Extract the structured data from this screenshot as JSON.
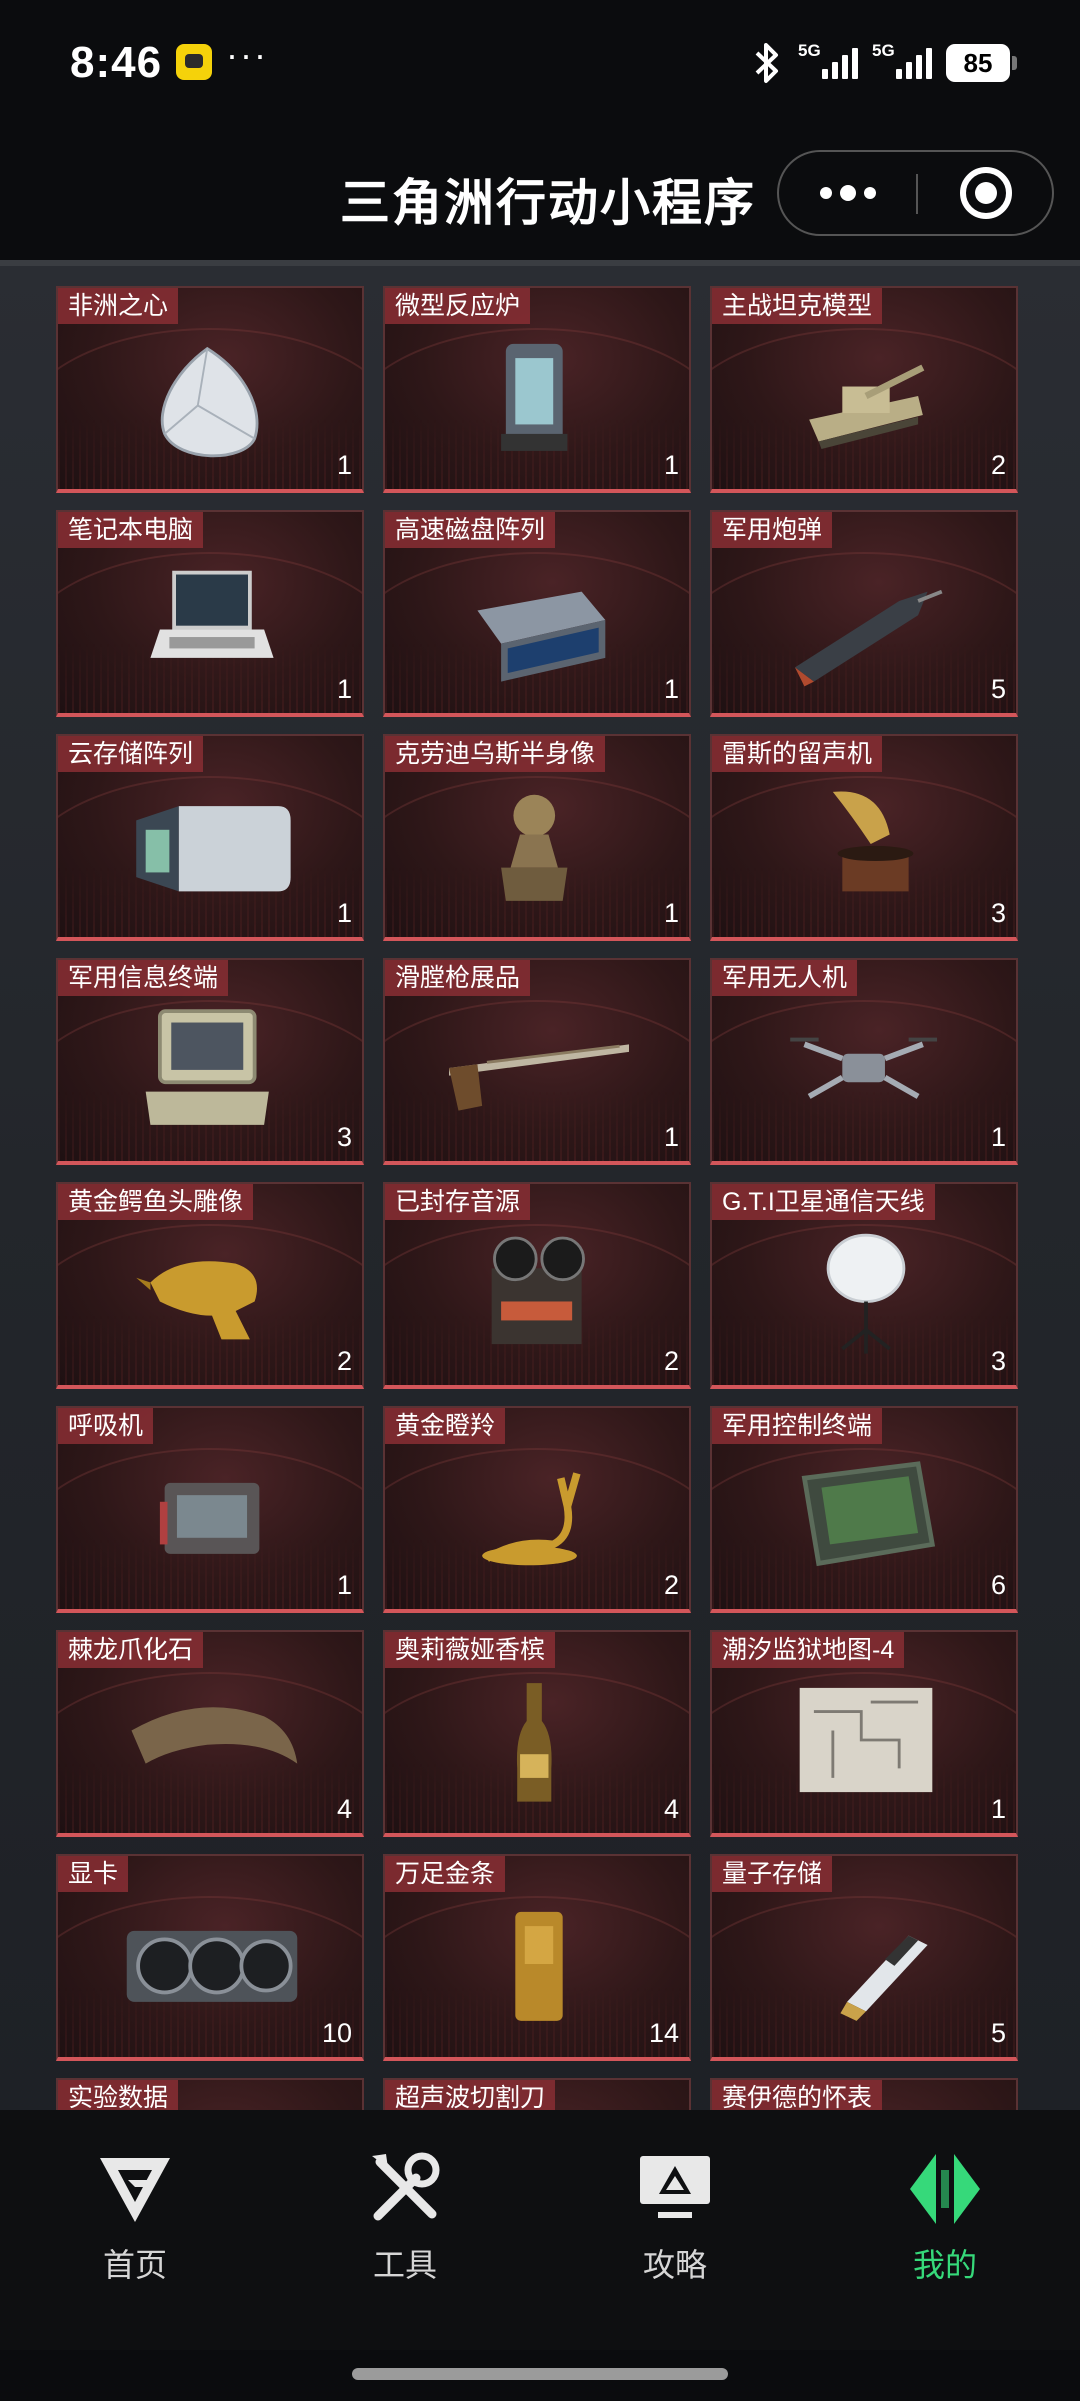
{
  "status_bar": {
    "time": "8:46",
    "more": "···",
    "signal1": "5G",
    "signal2": "5G",
    "battery": "85"
  },
  "header": {
    "title": "三角洲行动小程序"
  },
  "items": [
    {
      "name": "非洲之心",
      "count": "1",
      "icon": "diamond-icon"
    },
    {
      "name": "微型反应炉",
      "count": "1",
      "icon": "reactor-icon"
    },
    {
      "name": "主战坦克模型",
      "count": "2",
      "icon": "tank-icon"
    },
    {
      "name": "笔记本电脑",
      "count": "1",
      "icon": "laptop-icon"
    },
    {
      "name": "高速磁盘阵列",
      "count": "1",
      "icon": "disk-array-icon"
    },
    {
      "name": "军用炮弹",
      "count": "5",
      "icon": "shell-icon"
    },
    {
      "name": "云存储阵列",
      "count": "1",
      "icon": "cloud-storage-icon"
    },
    {
      "name": "克劳迪乌斯半身像",
      "count": "1",
      "icon": "bust-icon"
    },
    {
      "name": "雷斯的留声机",
      "count": "3",
      "icon": "gramophone-icon"
    },
    {
      "name": "军用信息终端",
      "count": "3",
      "icon": "terminal-case-icon"
    },
    {
      "name": "滑膛枪展品",
      "count": "1",
      "icon": "musket-icon"
    },
    {
      "name": "军用无人机",
      "count": "1",
      "icon": "drone-icon"
    },
    {
      "name": "黄金鳄鱼头雕像",
      "count": "2",
      "icon": "crocodile-statue-icon"
    },
    {
      "name": "已封存音源",
      "count": "2",
      "icon": "tape-recorder-icon"
    },
    {
      "name": "G.T.I卫星通信天线",
      "count": "3",
      "icon": "satellite-dish-icon"
    },
    {
      "name": "呼吸机",
      "count": "1",
      "icon": "ventilator-icon"
    },
    {
      "name": "黄金瞪羚",
      "count": "2",
      "icon": "gazelle-icon"
    },
    {
      "name": "军用控制终端",
      "count": "6",
      "icon": "control-terminal-icon"
    },
    {
      "name": "棘龙爪化石",
      "count": "4",
      "icon": "claw-fossil-icon"
    },
    {
      "name": "奥莉薇娅香槟",
      "count": "4",
      "icon": "champagne-icon"
    },
    {
      "name": "潮汐监狱地图-4",
      "count": "1",
      "icon": "map-icon"
    },
    {
      "name": "显卡",
      "count": "10",
      "icon": "gpu-icon"
    },
    {
      "name": "万足金条",
      "count": "14",
      "icon": "gold-bar-icon"
    },
    {
      "name": "量子存储",
      "count": "5",
      "icon": "quantum-storage-icon"
    },
    {
      "name": "实验数据",
      "count": "",
      "icon": ""
    },
    {
      "name": "超声波切割刀",
      "count": "",
      "icon": ""
    },
    {
      "name": "赛伊德的怀表",
      "count": "",
      "icon": ""
    }
  ],
  "tabs": [
    {
      "label": "首页",
      "icon": "home-logo-icon"
    },
    {
      "label": "工具",
      "icon": "tools-icon"
    },
    {
      "label": "攻略",
      "icon": "guide-icon"
    },
    {
      "label": "我的",
      "icon": "profile-logo-icon",
      "active": true
    }
  ],
  "colors": {
    "accent_green": "#36d97a",
    "card_red": "#d3565a",
    "label_red": "#822d32"
  }
}
